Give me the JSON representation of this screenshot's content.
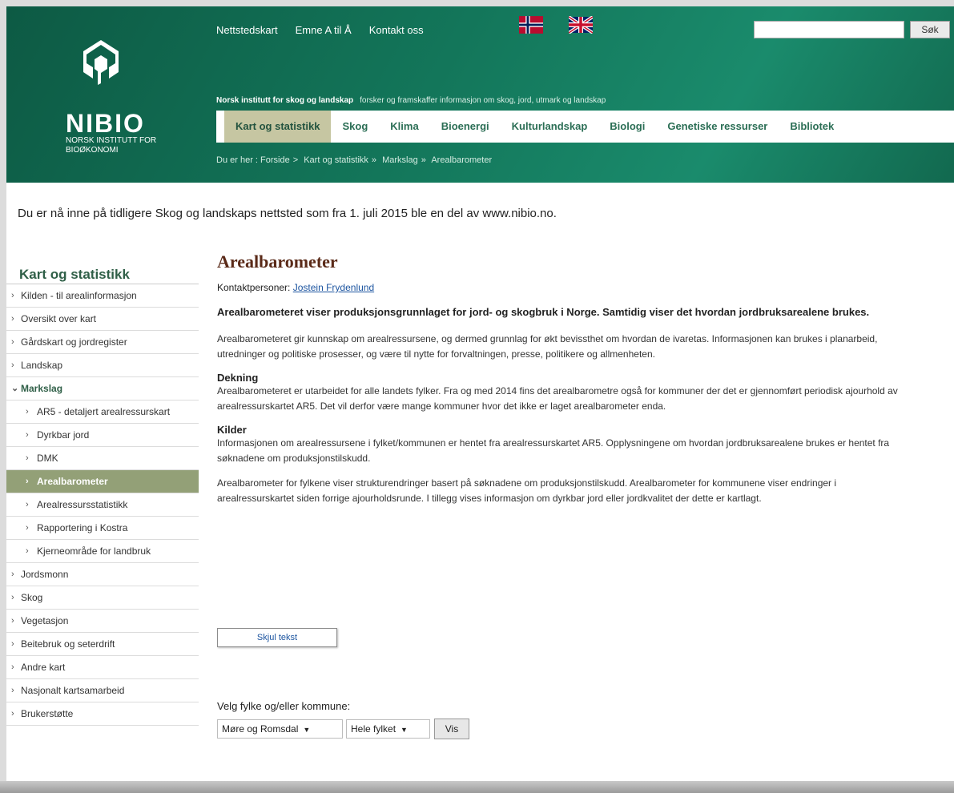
{
  "header": {
    "logo_name": "NIBIO",
    "logo_sub": "NORSK INSTITUTT FOR BIOØKONOMI",
    "top_links": [
      "Nettstedskart",
      "Emne A til Å",
      "Kontakt oss"
    ],
    "search": {
      "button_label": "Søk",
      "placeholder": ""
    },
    "tagline_org": "Norsk institutt for skog og landskap",
    "tagline_desc": "forsker og framskaffer informasjon om skog, jord, utmark og landskap",
    "nav": [
      "Kart og statistikk",
      "Skog",
      "Klima",
      "Bioenergi",
      "Kulturlandskap",
      "Biologi",
      "Genetiske ressurser",
      "Bibliotek"
    ],
    "nav_active": "Kart og statistikk",
    "breadcrumb": {
      "prefix": "Du er her :",
      "items": [
        "Forside",
        "Kart og statistikk",
        "Markslag",
        "Arealbarometer"
      ],
      "separators": [
        ">",
        ">",
        "»",
        "»"
      ]
    },
    "flag_colors": {
      "no_red": "#ba0c2f",
      "no_blue": "#00205b",
      "uk_blue": "#012169",
      "uk_red": "#c8102e"
    }
  },
  "notice": "Du er nå inne på tidligere Skog og landskaps nettsted som fra 1. juli 2015 ble en del av www.nibio.no.",
  "sidebar": {
    "title": "Kart og statistikk",
    "items": [
      {
        "label": "Kilden - til arealinformasjon",
        "level": 0,
        "state": ""
      },
      {
        "label": "Oversikt over kart",
        "level": 0,
        "state": ""
      },
      {
        "label": "Gårdskart og jordregister",
        "level": 0,
        "state": ""
      },
      {
        "label": "Landskap",
        "level": 0,
        "state": ""
      },
      {
        "label": "Markslag",
        "level": 0,
        "state": "open"
      },
      {
        "label": "AR5 - detaljert arealressurskart",
        "level": 1,
        "state": ""
      },
      {
        "label": "Dyrkbar jord",
        "level": 1,
        "state": ""
      },
      {
        "label": "DMK",
        "level": 1,
        "state": ""
      },
      {
        "label": "Arealbarometer",
        "level": 1,
        "state": "active"
      },
      {
        "label": "Arealressursstatistikk",
        "level": 1,
        "state": ""
      },
      {
        "label": "Rapportering i Kostra",
        "level": 1,
        "state": ""
      },
      {
        "label": "Kjerneområde for landbruk",
        "level": 1,
        "state": ""
      },
      {
        "label": "Jordsmonn",
        "level": 0,
        "state": ""
      },
      {
        "label": "Skog",
        "level": 0,
        "state": ""
      },
      {
        "label": "Vegetasjon",
        "level": 0,
        "state": ""
      },
      {
        "label": "Beitebruk og seterdrift",
        "level": 0,
        "state": ""
      },
      {
        "label": "Andre kart",
        "level": 0,
        "state": ""
      },
      {
        "label": "Nasjonalt kartsamarbeid",
        "level": 0,
        "state": ""
      },
      {
        "label": "Brukerstøtte",
        "level": 0,
        "state": ""
      }
    ]
  },
  "main": {
    "title": "Arealbarometer",
    "contact_label": "Kontaktpersoner:",
    "contact_name": "Jostein Frydenlund",
    "lead": "Arealbarometeret viser produksjonsgrunnlaget for jord- og skogbruk i Norge. Samtidig viser det hvordan jordbruksarealene brukes.",
    "intro": "Arealbarometeret gir kunnskap om arealressursene, og dermed grunnlag for økt bevissthet om hvordan de ivaretas. Informasjonen kan brukes i planarbeid, utredninger og politiske prosesser, og være til nytte for forvaltningen, presse, politikere og allmenheten.",
    "coverage_heading": "Dekning",
    "coverage_text": "Arealbarometeret er utarbeidet for alle landets fylker. Fra og med 2014 fins det arealbarometre også for kommuner der det er gjennomført periodisk ajourhold av arealressurskartet AR5. Det vil derfor være mange kommuner hvor det ikke er laget arealbarometer enda.",
    "sources_heading": "Kilder",
    "sources_text": "Informasjonen om arealressursene i fylket/kommunen er hentet fra arealressurskartet AR5. Opplysningene om hvordan jordbruksarealene brukes er hentet fra søknadene om produksjonstilskudd.",
    "closing_text": "Arealbarometer for fylkene viser strukturendringer basert på søknadene om produksjonstilskudd. Arealbarometer for kommunene viser endringer i arealressurskartet siden forrige ajourholdsrunde. I tillegg vises informasjon om dyrkbar jord eller jordkvalitet der dette er kartlagt.",
    "hide_text_button": "Skjul tekst",
    "select_label": "Velg fylke og/eller kommune:",
    "county_value": "Møre og Romsdal",
    "municipality_value": "Hele fylket",
    "vis_button": "Vis"
  }
}
